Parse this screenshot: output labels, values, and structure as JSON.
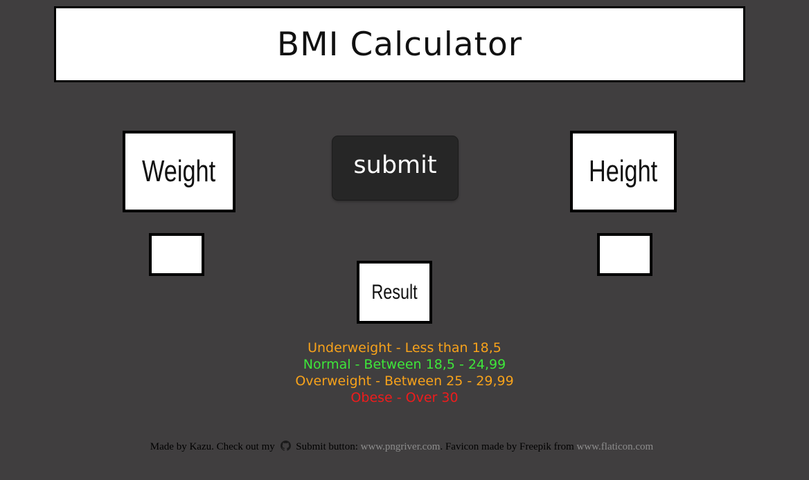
{
  "header": {
    "title": "BMI Calculator"
  },
  "inputs": {
    "weight_label": "Weight",
    "height_label": "Height",
    "weight_value": "",
    "height_value": ""
  },
  "actions": {
    "submit_label": "submit"
  },
  "result": {
    "label": "Result"
  },
  "legend": [
    {
      "text": "Underweight - Less than 18,5",
      "color": "#f7a21b"
    },
    {
      "text": "Normal - Between 18,5 - 24,99",
      "color": "#3ee63a"
    },
    {
      "text": "Overweight - Between 25 - 29,99",
      "color": "#f7a21b"
    },
    {
      "text": "Obese - Over 30",
      "color": "#ee1c1c"
    }
  ],
  "footer": {
    "made_by": "Made by Kazu. Check out my",
    "github_icon": "github-icon",
    "submit_credit": "Submit button:",
    "pngriver_link": "www.pngriver.com",
    "favicon_credit": ". Favicon made by Freepik from",
    "flaticon_link": "www.flaticon.com"
  },
  "colors": {
    "background": "#403e3f",
    "button": "#262626",
    "link": "#8c8c8c"
  }
}
